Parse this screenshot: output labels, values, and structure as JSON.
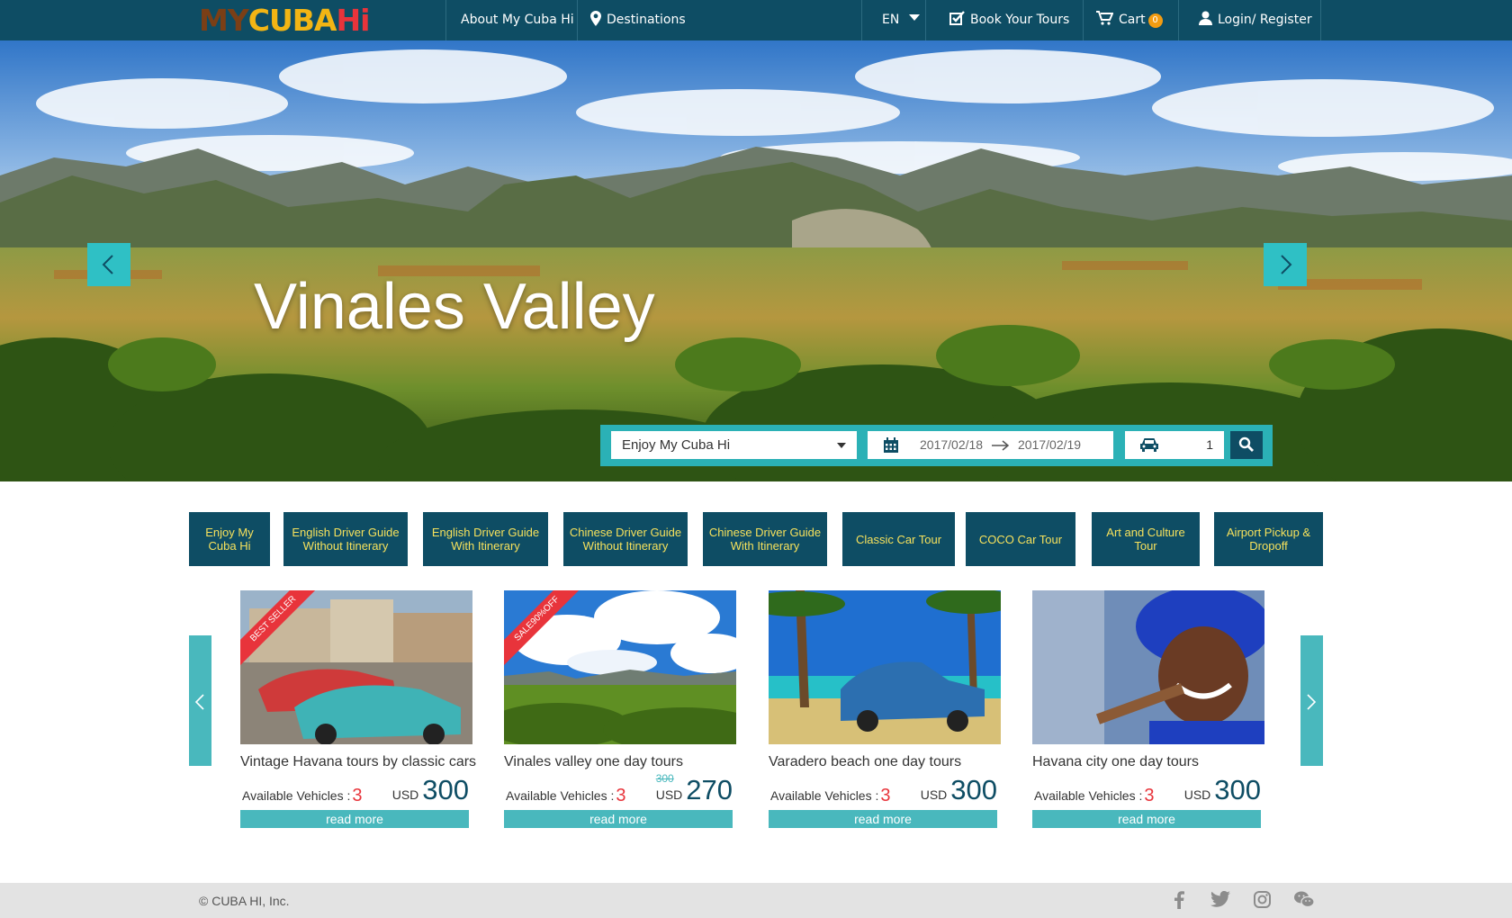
{
  "nav": {
    "logo": [
      "MY",
      " ",
      "CUBA",
      " ",
      "Hi"
    ],
    "about": "About My Cuba Hi",
    "destinations": "Destinations",
    "language": "EN",
    "book": "Book Your Tours",
    "cart": "Cart",
    "cart_count": "0",
    "login": "Login/ Register"
  },
  "hero": {
    "title": "Vinales Valley",
    "search": {
      "destination": "Enjoy My Cuba Hi",
      "date_from": "2017/02/18",
      "date_to": "2017/02/19",
      "vehicles": "1"
    }
  },
  "categories": [
    "Enjoy My Cuba Hi",
    "English Driver Guide Without Itinerary",
    "English Driver Guide With Itinerary",
    "Chinese Driver Guide Without Itinerary",
    "Chinese Driver Guide With Itinerary",
    "Classic Car Tour",
    "COCO Car Tour",
    "Art and Culture Tour",
    "Airport Pickup & Dropoff"
  ],
  "tours": [
    {
      "title": "Vintage Havana tours by classic cars",
      "ribbon": "BEST SELLER",
      "avail_label": "Available Vehicles :",
      "avail": "3",
      "currency": "USD",
      "old_price": "",
      "price": "300",
      "button": "read more"
    },
    {
      "title": "Vinales valley one day tours",
      "ribbon": "SALE90%OFF",
      "avail_label": "Available Vehicles :",
      "avail": "3",
      "currency": "USD",
      "old_price": "300",
      "price": "270",
      "button": "read more"
    },
    {
      "title": "Varadero beach one day tours",
      "ribbon": "",
      "avail_label": "Available Vehicles :",
      "avail": "3",
      "currency": "USD",
      "old_price": "",
      "price": "300",
      "button": "read more"
    },
    {
      "title": "Havana city one day tours",
      "ribbon": "",
      "avail_label": "Available Vehicles :",
      "avail": "3",
      "currency": "USD",
      "old_price": "",
      "price": "300",
      "button": "read more"
    }
  ],
  "footer": {
    "copyright": "© CUBA HI, Inc."
  },
  "colors": {
    "navy": "#0e4d64",
    "teal": "#2fc0c5",
    "accent_red": "#e8343b",
    "category_text": "#f6e15c"
  }
}
